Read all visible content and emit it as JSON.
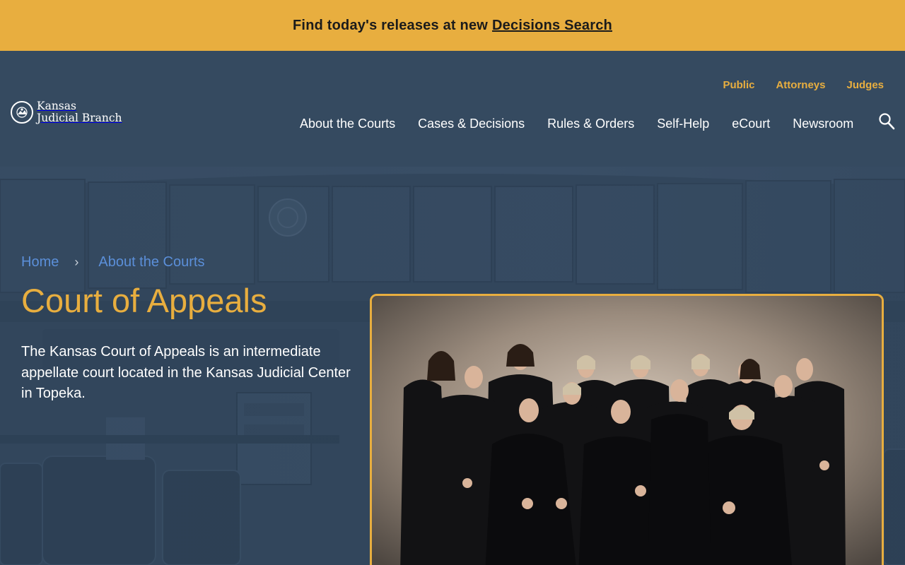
{
  "alert": {
    "text": "Find today's releases at new",
    "link": "Decisions Search"
  },
  "header": {
    "logo_line1": "Kansas",
    "logo_line2": "Judicial Branch",
    "utility_nav": [
      "Public",
      "Attorneys",
      "Judges"
    ],
    "main_nav": [
      "About the Courts",
      "Cases & Decisions",
      "Rules & Orders",
      "Self-Help",
      "eCourt",
      "Newsroom"
    ],
    "search_icon": "search-icon"
  },
  "breadcrumb": {
    "items": [
      "Home",
      "About the Courts"
    ],
    "separator": "›"
  },
  "page": {
    "title": "Court of Appeals",
    "intro": "The Kansas Court of Appeals is an intermediate appellate court located in the Kansas Judicial Center in Topeka."
  },
  "colors": {
    "accent": "#e8ae3f",
    "header_bg": "#354a60",
    "hero_bg": "#2f4359",
    "link": "#5b8fd9"
  }
}
